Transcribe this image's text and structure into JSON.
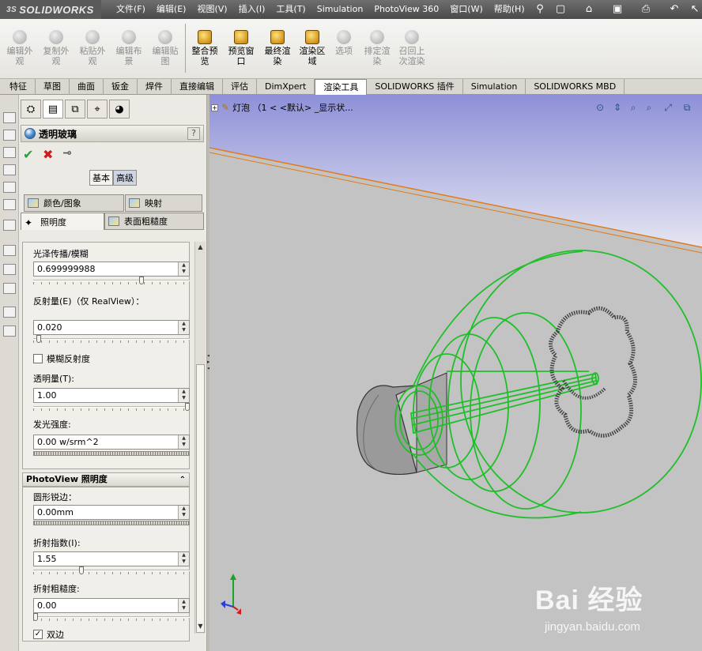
{
  "app": {
    "logo": "SOLIDWORKS",
    "logo_prefix": "3S"
  },
  "menu": [
    "文件(F)",
    "编辑(E)",
    "视图(V)",
    "插入(I)",
    "工具(T)",
    "Simulation",
    "PhotoView 360",
    "窗口(W)",
    "帮助(H)"
  ],
  "commands": [
    {
      "label": "编辑外观",
      "enabled": false
    },
    {
      "label": "复制外观",
      "enabled": false
    },
    {
      "label": "粘贴外观",
      "enabled": false
    },
    {
      "label": "编辑布景",
      "enabled": false
    },
    {
      "label": "编辑贴图",
      "enabled": false
    },
    {
      "label": "整合预览",
      "enabled": true
    },
    {
      "label": "预览窗口",
      "enabled": true
    },
    {
      "label": "最终渲染",
      "enabled": true
    },
    {
      "label": "渲染区域",
      "enabled": true
    },
    {
      "label": "选项",
      "enabled": false
    },
    {
      "label": "排定渲染",
      "enabled": false
    },
    {
      "label": "召回上次渲染",
      "enabled": false
    }
  ],
  "tabs": [
    "特征",
    "草图",
    "曲面",
    "钣金",
    "焊件",
    "直接编辑",
    "评估",
    "DimXpert",
    "渲染工具",
    "SOLIDWORKS 插件",
    "Simulation",
    "SOLIDWORKS MBD"
  ],
  "active_tab": "渲染工具",
  "pm": {
    "title": "透明玻璃",
    "help": "?",
    "ok": "✔",
    "cancel": "✖",
    "pin": "⊸",
    "mode_basic": "基本",
    "mode_advanced": "高级",
    "subtab_color": "颜色/图象",
    "subtab_mapping": "映射",
    "subtab_illumination": "照明度",
    "subtab_surface": "表面粗糙度",
    "gloss_label": "光泽传播/模糊",
    "gloss_value": "0.699999988",
    "reflect_label": "反射量(E)（仅 RealView）：",
    "reflect_value": "0.020",
    "blur_reflect_label": "模糊反射度",
    "transparency_label": "透明量(T):",
    "transparency_value": "1.00",
    "emission_label": "发光强度:",
    "emission_value": "0.00 w/srm^2",
    "photoview_title": "PhotoView 照明度",
    "round_edge_label": "圆形锐边：",
    "round_edge_value": "0.00mm",
    "refraction_label": "折射指数(I):",
    "refraction_value": "1.55",
    "refr_rough_label": "折射粗糙度:",
    "refr_rough_value": "0.00",
    "double_sided_label": "双边",
    "double_sided_checked": true,
    "sliders": {
      "gloss": 0.7,
      "reflect": 0.02,
      "transparency": 1.0,
      "refraction": 0.3,
      "refr_rough": 0.0
    }
  },
  "viewport": {
    "tree_label": "灯泡 （1 < <默认> _显示状...",
    "watermark_logo": "Bai 经验",
    "watermark_url": "jingyan.baidu.com"
  },
  "colors": {
    "wireframe": "#1fbf2a",
    "horizon": "#e07a1a",
    "background_top": "#8d90d8",
    "background_floor": "#c3c3c3"
  }
}
